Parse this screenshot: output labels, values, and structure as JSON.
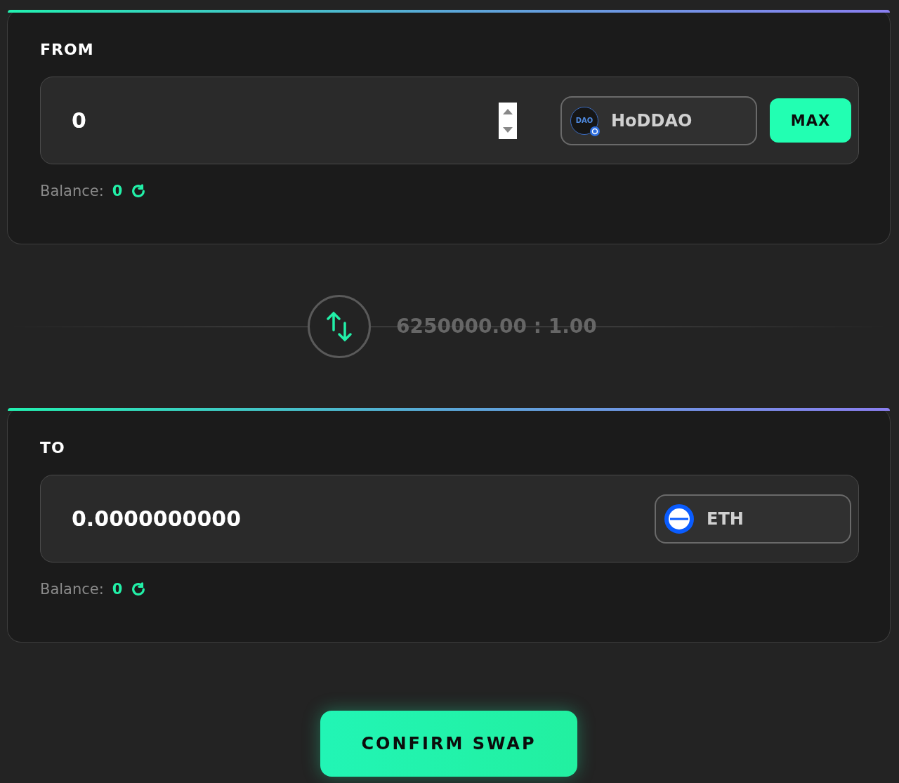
{
  "from": {
    "title": "FROM",
    "amount": "0",
    "kind": "stepper",
    "token": {
      "kind": "dao",
      "logo_text": "DAO",
      "name": "HoDDAO"
    },
    "max_button": "MAX",
    "balance_label": "Balance:",
    "balance_value": "0"
  },
  "rate": "6250000.00 : 1.00",
  "to": {
    "title": "TO",
    "amount": "0.0000000000",
    "token": {
      "kind": "eth",
      "name": "ETH"
    },
    "balance_label": "Balance:",
    "balance_value": "0"
  },
  "confirm_button": "CONFIRM SWAP"
}
